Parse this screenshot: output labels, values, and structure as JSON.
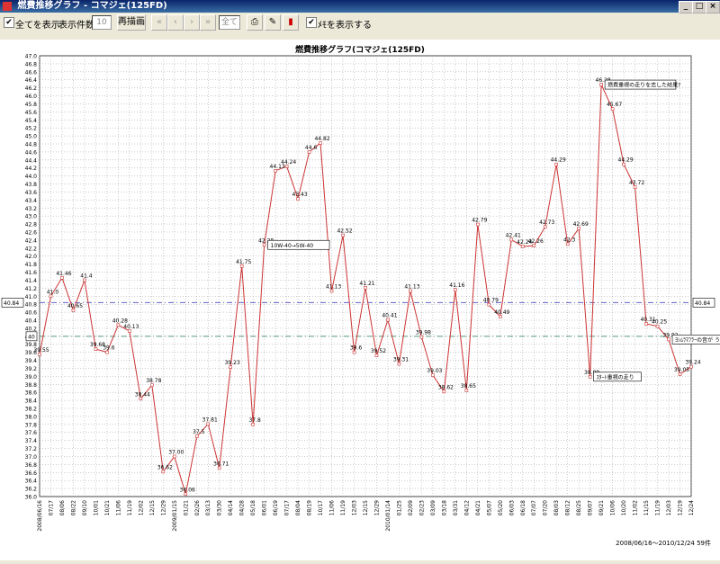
{
  "window": {
    "title": "燃費推移グラフ - コマジェ(125FD)",
    "min": "_",
    "max": "□",
    "close": "×"
  },
  "toolbar": {
    "show_all_label": "全てを表示",
    "count_label": "表示件数",
    "count_value": "10",
    "redraw_label": "再描画",
    "nav_first": "«",
    "nav_prev": "‹",
    "nav_next": "›",
    "nav_last": "»",
    "range_value": "全て",
    "show_memo_label": "ﾒﾓを表示する"
  },
  "chart_data": {
    "type": "line",
    "title": "燃費推移グラフ(コマジェ(125FD)",
    "ylim": [
      36.0,
      47.0
    ],
    "ytick_step": 0.2,
    "grid": true,
    "series_color": "#cc3333",
    "points": [
      {
        "x": "2008/06/16",
        "y": 39.55
      },
      {
        "x": "2008/07/08",
        "y": 41.0
      },
      {
        "x": "2008/07/27",
        "y": 41.46
      },
      {
        "x": "2008/08/23",
        "y": 40.65
      },
      {
        "x": "2008/09/12",
        "y": 41.4
      },
      {
        "x": "2008/10/01",
        "y": 39.68
      },
      {
        "x": "2008/10/18",
        "y": 39.6
      },
      {
        "x": "2008/11/06",
        "y": 40.28
      },
      {
        "x": "2008/11/22",
        "y": 40.13
      },
      {
        "x": "2008/12/06",
        "y": 38.44
      },
      {
        "x": "2008/12/22",
        "y": 38.78
      },
      {
        "x": "2009/01/06",
        "y": 36.62
      },
      {
        "x": "2009/01/20",
        "y": 37.0
      },
      {
        "x": "2009/01/28",
        "y": 36.06
      },
      {
        "x": "2009/02/18",
        "y": 37.5
      },
      {
        "x": "2009/03/04",
        "y": 37.81
      },
      {
        "x": "2009/03/20",
        "y": 36.71
      },
      {
        "x": "2009/04/03",
        "y": 39.23
      },
      {
        "x": "2009/04/18",
        "y": 41.75
      },
      {
        "x": "2009/05/03",
        "y": 37.8
      },
      {
        "x": "2009/05/20",
        "y": 42.28
      },
      {
        "x": "2009/06/06",
        "y": 44.13
      },
      {
        "x": "2009/06/22",
        "y": 44.24
      },
      {
        "x": "2009/07/06",
        "y": 43.43
      },
      {
        "x": "2009/07/22",
        "y": 44.6
      },
      {
        "x": "2009/08/04",
        "y": 44.82
      },
      {
        "x": "2009/08/21",
        "y": 41.13
      },
      {
        "x": "2009/09/05",
        "y": 42.52
      },
      {
        "x": "2009/09/24",
        "y": 39.6
      },
      {
        "x": "2009/10/10",
        "y": 41.21
      },
      {
        "x": "2009/10/28",
        "y": 39.52
      },
      {
        "x": "2009/11/12",
        "y": 40.41
      },
      {
        "x": "2009/11/28",
        "y": 39.31
      },
      {
        "x": "2009/12/14",
        "y": 41.13
      },
      {
        "x": "2009/12/30",
        "y": 39.98
      },
      {
        "x": "2010/01/14",
        "y": 39.03
      },
      {
        "x": "2010/02/01",
        "y": 38.62
      },
      {
        "x": "2010/02/16",
        "y": 41.16
      },
      {
        "x": "2010/03/02",
        "y": 38.65
      },
      {
        "x": "2010/03/20",
        "y": 42.79
      },
      {
        "x": "2010/04/06",
        "y": 40.79
      },
      {
        "x": "2010/04/24",
        "y": 40.49
      },
      {
        "x": "2010/05/10",
        "y": 42.41
      },
      {
        "x": "2010/05/26",
        "y": 42.24
      },
      {
        "x": "2010/06/10",
        "y": 42.26
      },
      {
        "x": "2010/06/26",
        "y": 42.73
      },
      {
        "x": "2010/07/12",
        "y": 44.29
      },
      {
        "x": "2010/07/28",
        "y": 42.3
      },
      {
        "x": "2010/08/12",
        "y": 42.69
      },
      {
        "x": "2010/08/28",
        "y": 38.99
      },
      {
        "x": "2010/09/12",
        "y": 46.28
      },
      {
        "x": "2010/09/28",
        "y": 45.67
      },
      {
        "x": "2010/10/14",
        "y": 44.29
      },
      {
        "x": "2010/10/28",
        "y": 43.72
      },
      {
        "x": "2010/11/12",
        "y": 40.31
      },
      {
        "x": "2010/11/28",
        "y": 40.25
      },
      {
        "x": "2010/12/08",
        "y": 39.92
      },
      {
        "x": "2010/12/16",
        "y": 39.05
      },
      {
        "x": "2010/12/24",
        "y": 39.24
      }
    ],
    "point_labels": [
      "39.55",
      "41.0",
      "41.46",
      "40.65",
      "41.4",
      "39.68",
      "39.6",
      "40.28",
      "40.13",
      "38.44",
      "38.78",
      "36.62",
      "37.00",
      "36.06",
      "37.5",
      "37.81",
      "36.71",
      "39.23",
      "41.75",
      "37.8",
      "42.28",
      "44.13",
      "44.24",
      "43.43",
      "44.6",
      "44.82",
      "41.13",
      "42.52",
      "39.6",
      "41.21",
      "39.52",
      "40.41",
      "39.31",
      "41.13",
      "39.98",
      "39.03",
      "38.62",
      "41.16",
      "38.65",
      "42.79",
      "40.79",
      "40.49",
      "42.41",
      "42.24",
      "42.26",
      "42.73",
      "44.29",
      "42.3",
      "42.69",
      "38.99",
      "46.28",
      "45.67",
      "44.29",
      "43.72",
      "40.31",
      "40.25",
      "39.92",
      "39.05",
      "39.24"
    ],
    "average": {
      "value": 40.84,
      "label": "40.84"
    },
    "reference": {
      "value": 40.0,
      "label": "40"
    },
    "x_tick_labels": [
      "2008/06/16",
      "07/17",
      "08/06",
      "08/22",
      "09/10",
      "10/01",
      "10/21",
      "11/06",
      "11/19",
      "12/02",
      "12/15",
      "12/29",
      "2009/01/15",
      "01/21",
      "02/26",
      "03/13",
      "03/30",
      "04/14",
      "04/28",
      "05/18",
      "06/01",
      "06/19",
      "07/17",
      "08/04",
      "08/19",
      "10/17",
      "11/06",
      "11/19",
      "12/03",
      "12/15",
      "12/29",
      "2010/01/14",
      "01/25",
      "02/09",
      "02/23",
      "03/09",
      "03/18",
      "03/31",
      "04/12",
      "04/21",
      "05/07",
      "05/20",
      "06/03",
      "06/18",
      "07/07",
      "07/20",
      "08/03",
      "08/12",
      "08/25",
      "09/07",
      "09/21",
      "10/06",
      "10/20",
      "11/02",
      "11/15",
      "11/19",
      "12/03",
      "12/19",
      "12/24"
    ],
    "annotations": [
      {
        "text": "10W-40→5W-40",
        "point_index": 20
      },
      {
        "text": "燃費重視の走りを志した結果?",
        "point_index": 50
      },
      {
        "text": "ｽﾀｰﾄ重視の走り",
        "point_index": 49
      },
      {
        "text": "ﾖｼﾑﾗﾏﾌﾗｰの音が うる",
        "point_index": 56
      }
    ],
    "footer": "2008/06/16〜2010/12/24  59件"
  }
}
